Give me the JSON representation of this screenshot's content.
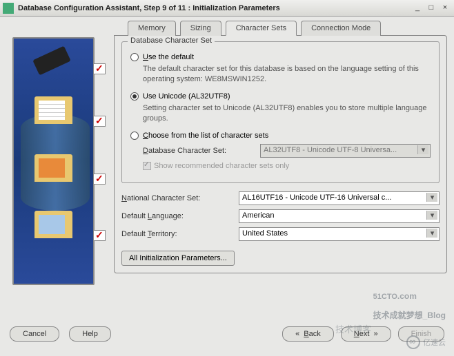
{
  "window": {
    "title": "Database Configuration Assistant, Step 9 of 11 : Initialization Parameters"
  },
  "tabs": [
    "Memory",
    "Sizing",
    "Character Sets",
    "Connection Mode"
  ],
  "fieldset_legend": "Database Character Set",
  "radio1": {
    "label": "Use the default",
    "desc": "The default character set for this database is based on the language setting of this operating system: WE8MSWIN1252."
  },
  "radio2": {
    "label": "Use Unicode (AL32UTF8)",
    "desc": "Setting character set to Unicode (AL32UTF8) enables you to store multiple language groups."
  },
  "radio3": {
    "label": "Choose from the list of character sets",
    "db_cs_label": "Database Character Set:",
    "db_cs_value": "AL32UTF8 - Unicode UTF-8 Universa...",
    "show_rec": "Show recommended character sets only"
  },
  "nat_cs_label": "National Character Set:",
  "nat_cs_value": "AL16UTF16 - Unicode UTF-16 Universal c...",
  "def_lang_label": "Default Language:",
  "def_lang_value": "American",
  "def_terr_label": "Default Territory:",
  "def_terr_value": "United States",
  "all_params": "All Initialization Parameters...",
  "buttons": {
    "cancel": "Cancel",
    "help": "Help",
    "back": "Back",
    "next": "Next",
    "finish": "Finish"
  },
  "watermarks": {
    "w1a": "51CTO",
    "w1b": ".com",
    "w1c": "技术成就梦想_Blog",
    "w2": "亿速云",
    "w3": "技术博客"
  }
}
